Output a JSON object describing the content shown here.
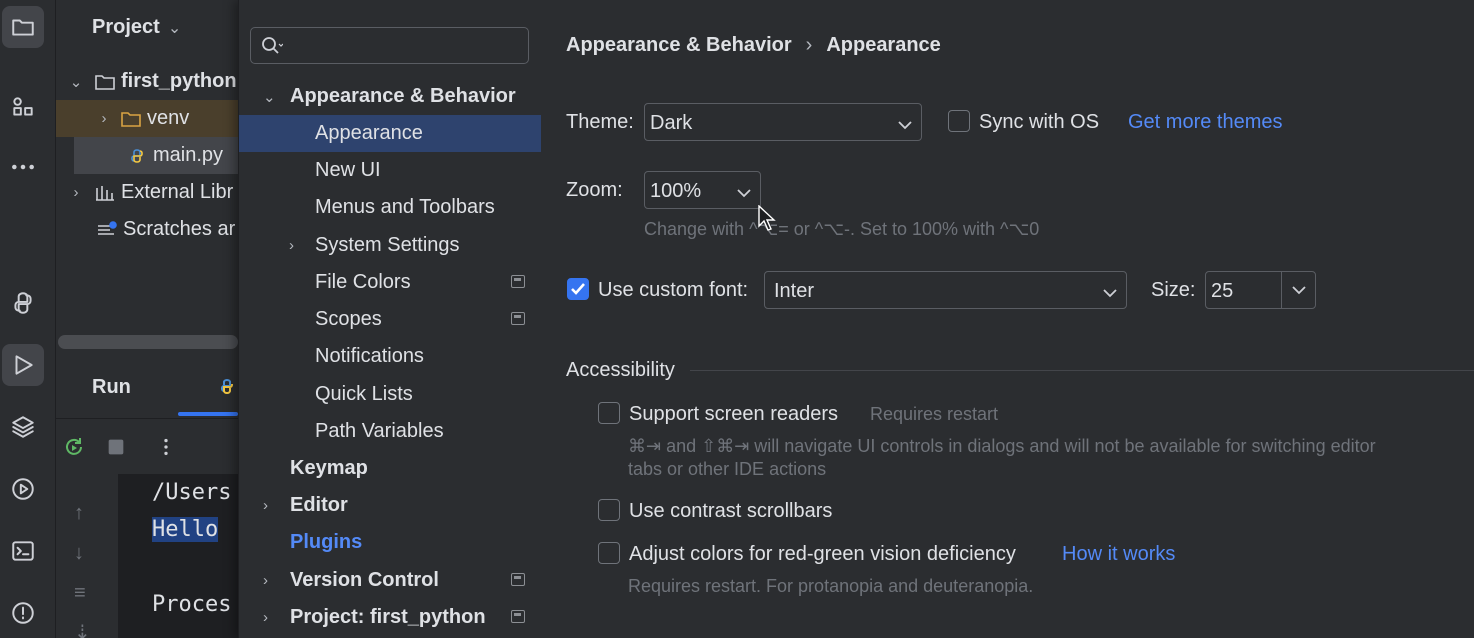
{
  "project_pane": {
    "title": "Project",
    "tree": [
      {
        "label": "first_python"
      },
      {
        "label": "venv"
      },
      {
        "label": "main.py"
      },
      {
        "label": "External Libr"
      },
      {
        "label": "Scratches ar"
      }
    ]
  },
  "run_pane": {
    "title": "Run",
    "console_lines": [
      "/Users",
      "Hello ",
      "Proces"
    ]
  },
  "settings": {
    "search": {
      "value": "",
      "placeholder": ""
    },
    "nav": [
      {
        "label": "Appearance & Behavior"
      },
      {
        "label": "Appearance"
      },
      {
        "label": "New UI"
      },
      {
        "label": "Menus and Toolbars"
      },
      {
        "label": "System Settings"
      },
      {
        "label": "File Colors"
      },
      {
        "label": "Scopes"
      },
      {
        "label": "Notifications"
      },
      {
        "label": "Quick Lists"
      },
      {
        "label": "Path Variables"
      },
      {
        "label": "Keymap"
      },
      {
        "label": "Editor"
      },
      {
        "label": "Plugins"
      },
      {
        "label": "Version Control"
      },
      {
        "label": "Project: first_python"
      }
    ],
    "breadcrumb": {
      "parent": "Appearance & Behavior",
      "separator": "›",
      "current": "Appearance"
    },
    "theme": {
      "label": "Theme:",
      "value": "Dark",
      "sync_label": "Sync with OS",
      "sync_checked": false,
      "more_link": "Get more themes"
    },
    "zoom": {
      "label": "Zoom:",
      "value": "100%",
      "hint": "Change with ^⌥= or ^⌥-. Set to 100% with ^⌥0"
    },
    "font": {
      "checkbox_label": "Use custom font:",
      "checked": true,
      "value": "Inter",
      "size_label": "Size:",
      "size_value": "25"
    },
    "accessibility": {
      "heading": "Accessibility",
      "screen_readers": {
        "label": "Support screen readers",
        "note": "Requires restart",
        "checked": false,
        "description": "⌘⇥ and ⇧⌘⇥ will navigate UI controls in dialogs and will not be available for switching editor tabs or other IDE actions"
      },
      "contrast_scrollbars": {
        "label": "Use contrast scrollbars",
        "checked": false
      },
      "color_deficiency": {
        "label": "Adjust colors for red-green vision deficiency",
        "link": "How it works",
        "checked": false,
        "note": "Requires restart. For protanopia and deuteranopia."
      }
    }
  },
  "colors": {
    "accent": "#3574f0",
    "link": "#548af7",
    "selection": "#2e436e",
    "background": "#2b2d30"
  }
}
